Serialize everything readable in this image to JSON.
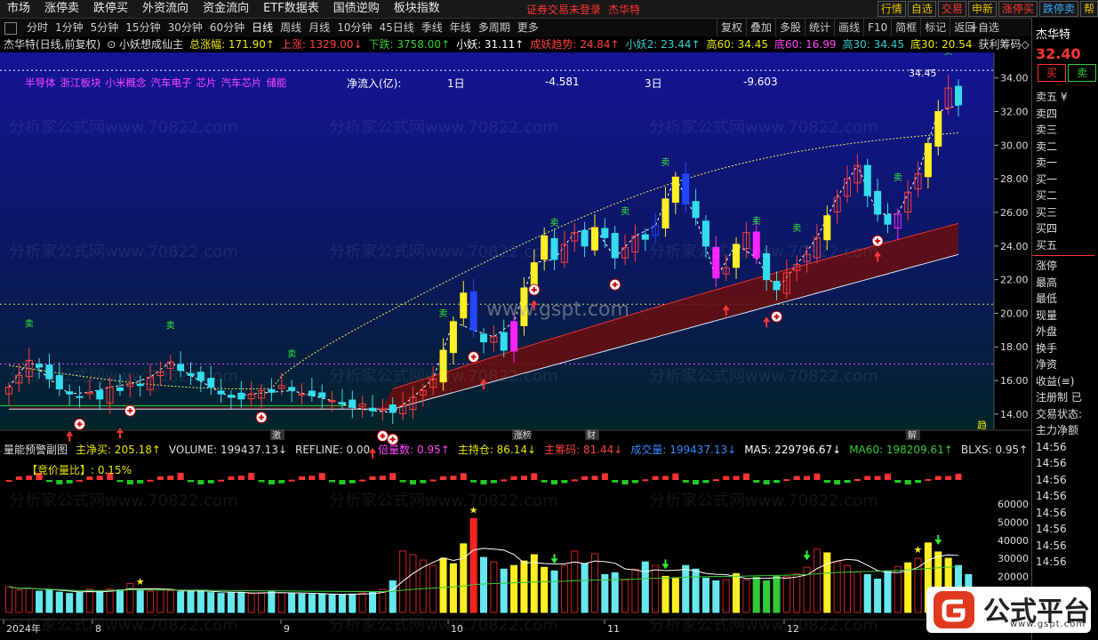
{
  "topbar": {
    "menu": [
      "市场",
      "涨停卖",
      "跌停买",
      "外资流向",
      "资金流向",
      "ETF数据表",
      "国债逆购",
      "板块指数"
    ],
    "center_notice": "证券交易未登录",
    "center_name": "杰华特",
    "right_tags": [
      {
        "label": "行情",
        "color": "#e8c000"
      },
      {
        "label": "自选",
        "color": "#e8c000"
      },
      {
        "label": "交易",
        "color": "#ff3333"
      },
      {
        "label": "申新",
        "color": "#e8c000"
      },
      {
        "label": "涨停买",
        "color": "#ff3333"
      },
      {
        "label": "跌停卖",
        "color": "#33aaff"
      },
      {
        "label": "帮",
        "color": "#e8c000"
      }
    ]
  },
  "periodbar": {
    "periods": [
      "分时",
      "1分钟",
      "5分钟",
      "15分钟",
      "30分钟",
      "60分钟",
      "日线",
      "周线",
      "月线",
      "10分钟",
      "45日线",
      "季线",
      "年线",
      "多周期",
      "更多"
    ],
    "active": "日线",
    "tools": [
      "复权",
      "叠加",
      "多股",
      "统计",
      "画线",
      "F10",
      "简框",
      "标记",
      "返回"
    ]
  },
  "infobar": {
    "items": [
      {
        "text": "杰华特(日线,前复权)",
        "color": "#dddddd"
      },
      {
        "text": "⊙ 小妖想成仙主",
        "color": "#dddddd"
      },
      {
        "text": "总涨幅: 171.90↑",
        "color": "#e8e800"
      },
      {
        "text": "上涨: 1329.00↓",
        "color": "#ff4040"
      },
      {
        "text": "下跌: 3758.00↑",
        "color": "#33cc33"
      },
      {
        "text": "小妖: 31.11↑",
        "color": "#ffffff"
      },
      {
        "text": "成妖趋势: 24.84↑",
        "color": "#ff4040"
      },
      {
        "text": "小妖2: 23.44↑",
        "color": "#33cccc"
      },
      {
        "text": "高60: 34.45",
        "color": "#e8e800"
      },
      {
        "text": "底60: 16.99",
        "color": "#ff44ff"
      },
      {
        "text": "高30: 34.45",
        "color": "#33cccc"
      },
      {
        "text": "底30: 20.54",
        "color": "#e8e800"
      },
      {
        "text": "获利筹码◇",
        "color": "#dddddd"
      }
    ]
  },
  "main_chart": {
    "sectors": [
      "半导体",
      "浙江板块",
      "小米概念",
      "汽车电子",
      "芯片",
      "汽车芯片",
      "储能"
    ],
    "netflow_label": "净流入(亿):",
    "netflow_1d_label": "1日",
    "netflow_1d_value": "-4.581",
    "netflow_3d_label": "3日",
    "netflow_3d_value": "-9.603",
    "high_label": "34.45",
    "y_ticks": [
      "34.00",
      "32.00",
      "30.00",
      "28.00",
      "26.00",
      "24.00",
      "22.00",
      "20.00",
      "18.00",
      "16.00",
      "14.00"
    ],
    "watermark_main": "www.gspt.com",
    "watermark_tile": "分析家公式网www.70822.com",
    "event_tags": [
      "激",
      "涨榜",
      "财",
      "解"
    ],
    "trail_label": "趋"
  },
  "sub_chart": {
    "header": [
      {
        "text": "量能预警副图",
        "color": "#dddddd"
      },
      {
        "text": "主净买: 205.18↑",
        "color": "#e8e800"
      },
      {
        "text": "VOLUME: 199437.13↓",
        "color": "#dddddd"
      },
      {
        "text": "REFLINE: 0.00",
        "color": "#dddddd"
      },
      {
        "text": "倍量数: 0.95↑",
        "color": "#ff44ff"
      },
      {
        "text": "主持仓: 86.14↓",
        "color": "#e8e800"
      },
      {
        "text": "主筹码: 81.44↓",
        "color": "#ff4040"
      },
      {
        "text": "成交量: 199437.13↓",
        "color": "#3388ff"
      },
      {
        "text": "MA5: 229796.67↓",
        "color": "#ffffff"
      },
      {
        "text": "MA60: 198209.61↑",
        "color": "#33cc33"
      },
      {
        "text": "BLXS: 0.95↑",
        "color": "#dddddd"
      },
      {
        "text": "竞价量",
        "color": "#ff44ff"
      }
    ],
    "auction_ratio": "【竞价量比】: 0.15%",
    "y_ticks": [
      "60000",
      "50000",
      "40000",
      "30000",
      "20000"
    ],
    "x_ticks": [
      "2024年",
      "8",
      "9",
      "10",
      "11",
      "12"
    ]
  },
  "rightpanel": {
    "stock_name": "杰华特",
    "price": "32.40",
    "buy_button": "买",
    "sell_button": "卖",
    "orderbook": [
      "卖五 ¥",
      "卖四",
      "卖三",
      "卖二",
      "卖一",
      "买一",
      "买二",
      "买三",
      "买四",
      "买五"
    ],
    "stats": [
      "涨停",
      "最高",
      "最低",
      "现量",
      "外盘",
      "换手",
      "净资",
      "收益(≡)",
      "注册制 已",
      "交易状态:",
      "主力净额"
    ],
    "times": [
      "14:56",
      "14:56",
      "14:56",
      "14:56",
      "14:56",
      "14:56",
      "14:56",
      "14:56"
    ]
  },
  "logo": {
    "text": "公式平台",
    "sub": "www.gspt.com",
    "accent": "#e03a1e"
  },
  "chart_data": {
    "type": "candlestick",
    "x_axis_labels": [
      "2024年",
      "8",
      "9",
      "10",
      "11",
      "12"
    ],
    "y_range": [
      13.2,
      35.2
    ],
    "candles_close": [
      15.6,
      16.3,
      17.2,
      16.8,
      16.1,
      15.5,
      15.2,
      15.0,
      15.3,
      14.9,
      15.6,
      15.4,
      15.8,
      15.7,
      16.2,
      16.5,
      17.1,
      16.6,
      16.3,
      16.0,
      15.6,
      15.2,
      15.0,
      14.9,
      15.2,
      15.4,
      15.3,
      15.7,
      15.4,
      15.2,
      15.1,
      15.0,
      14.8,
      14.6,
      14.4,
      14.6,
      14.2,
      14.3,
      14.1,
      14.5,
      15.0,
      15.4,
      16.1,
      17.8,
      19.5,
      21.2,
      19.0,
      18.3,
      18.6,
      17.8,
      19.5,
      21.5,
      23.0,
      24.6,
      23.2,
      24.1,
      24.8,
      24.0,
      25.1,
      24.5,
      23.3,
      23.9,
      24.6,
      24.4,
      25.2,
      26.8,
      28.1,
      26.5,
      25.7,
      24.0,
      22.1,
      22.7,
      24.1,
      24.8,
      23.3,
      22.0,
      21.4,
      22.4,
      22.9,
      23.5,
      24.5,
      25.8,
      26.9,
      28.0,
      28.8,
      27.0,
      25.9,
      25.3,
      25.9,
      27.2,
      28.3,
      30.1,
      32.0,
      33.4,
      32.4
    ],
    "volume": [
      14200,
      12500,
      13500,
      11800,
      12400,
      11200,
      10500,
      11000,
      12800,
      11500,
      13000,
      12500,
      16000,
      12200,
      11800,
      12400,
      12000,
      11500,
      11800,
      12200,
      11000,
      10500,
      10800,
      11200,
      10400,
      11000,
      11500,
      10800,
      10500,
      10200,
      10000,
      10400,
      9800,
      9900,
      10200,
      10800,
      11500,
      12800,
      17500,
      34000,
      32000,
      29000,
      26000,
      30000,
      27000,
      38000,
      52000,
      30500,
      28000,
      24000,
      26000,
      28500,
      32000,
      25000,
      23000,
      26000,
      34000,
      27000,
      32500,
      21000,
      22000,
      18000,
      24000,
      28000,
      26000,
      20000,
      19000,
      26000,
      24000,
      19000,
      17500,
      18000,
      21500,
      18000,
      19500,
      17500,
      20000,
      19800,
      21500,
      25000,
      35000,
      33000,
      28000,
      26000,
      22500,
      21000,
      18500,
      23000,
      25500,
      27500,
      30000,
      38500,
      33500,
      30000,
      26000,
      21000
    ],
    "ma5_last": 229796.67,
    "ma60_last": 198209.61,
    "high60": 34.45,
    "low60": 16.99,
    "last_price": 32.4
  }
}
